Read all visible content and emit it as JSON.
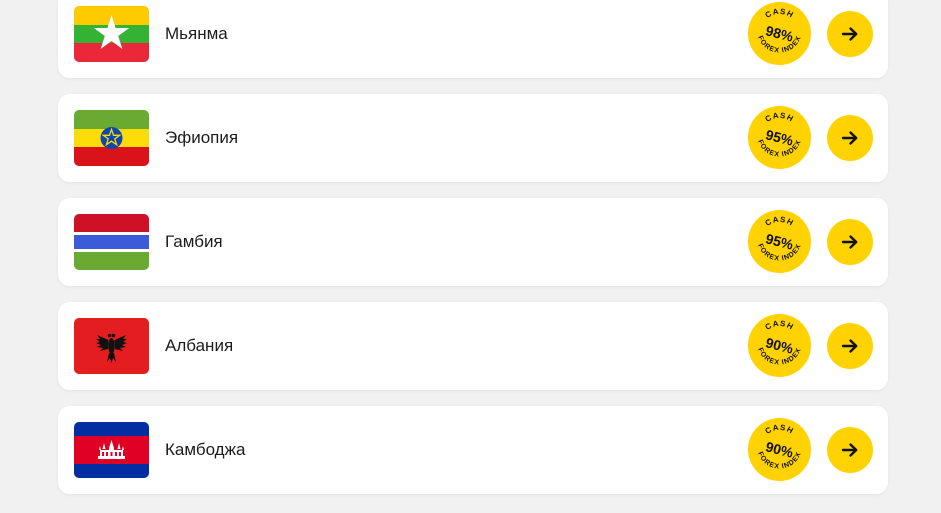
{
  "countries": [
    {
      "name": "Мьянма",
      "flag": "myanmar-flag",
      "badge": {
        "top": "CASH",
        "percent": "98%",
        "bottom": "FOREX INDEX"
      }
    },
    {
      "name": "Эфиопия",
      "flag": "ethiopia-flag",
      "badge": {
        "top": "CASH",
        "percent": "95%",
        "bottom": "FOREX INDEX"
      }
    },
    {
      "name": "Гамбия",
      "flag": "gambia-flag",
      "badge": {
        "top": "CASH",
        "percent": "95%",
        "bottom": "FOREX INDEX"
      }
    },
    {
      "name": "Албания",
      "flag": "albania-flag",
      "badge": {
        "top": "CASH",
        "percent": "90%",
        "bottom": "FOREX INDEX"
      }
    },
    {
      "name": "Камбоджа",
      "flag": "cambodia-flag",
      "badge": {
        "top": "CASH",
        "percent": "90%",
        "bottom": "FOREX INDEX"
      }
    }
  ],
  "colors": {
    "accent_yellow": "#ffd200",
    "card_bg": "#ffffff",
    "page_bg": "#f1f1f1",
    "text": "#1c1c1c"
  },
  "icons": {
    "arrow": "arrow-right-icon"
  }
}
